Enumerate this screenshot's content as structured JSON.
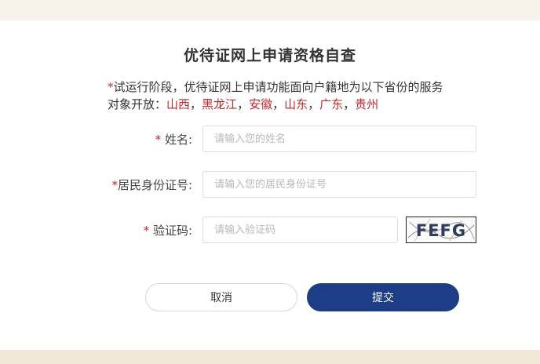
{
  "form": {
    "title": "优待证网上申请资格自查",
    "notice": {
      "star": "*",
      "line1": "试运行阶段，优待证网上申请功能面向户籍地为以下省份的服务",
      "line2_prefix": "对象开放：",
      "provinces": [
        "山西",
        "黑龙江",
        "安徽",
        "山东",
        "广东",
        "贵州"
      ],
      "separator": "，"
    },
    "fields": {
      "name": {
        "required_mark": "*",
        "label": "姓名:",
        "placeholder": "请输入您的姓名",
        "value": ""
      },
      "id_number": {
        "required_mark": "*",
        "label": "居民身份证号:",
        "placeholder": "请输入您的居民身份证号",
        "value": ""
      },
      "captcha": {
        "required_mark": "*",
        "label": "验证码:",
        "placeholder": "请输入验证码",
        "value": "",
        "image_text": "FEFG"
      }
    },
    "buttons": {
      "cancel": "取消",
      "submit": "提交"
    }
  },
  "colors": {
    "required": "#c0272d",
    "province": "#c0272d",
    "submit_bg": "#1d3e86",
    "page_bg": "#fbf8f2"
  }
}
